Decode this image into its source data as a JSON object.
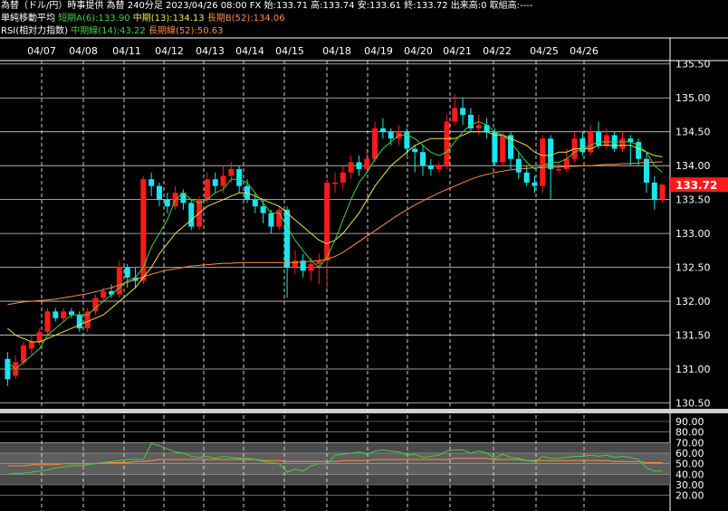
{
  "header": {
    "title_line": "為替（ドル/円）時事提供 為替 240分足 2023/04/26 08:00 FX 始:133.71 高:133.74 安:133.61 終:133.72 出来高:0 取組高:----",
    "ma_label": "単純移動平均",
    "ma_short": "短期A(6):133.90",
    "ma_mid": "中期(13):134.13",
    "ma_long": "長期B(52):134.06",
    "rsi_label": "RSI(相対力指数)",
    "rsi_mid": "中期線(14):43.22",
    "rsi_long": "長期線(52):50.63"
  },
  "colors": {
    "up": "#ff1a1a",
    "down": "#18e6f0",
    "ma_short": "#3fd13f",
    "ma_mid": "#e8e84a",
    "ma_long": "#ff8c42",
    "price_tag": "#ff1a1a"
  },
  "chart_data": [
    {
      "type": "candlestick",
      "title": "為替（ドル/円）240分足",
      "dates": [
        "04/07",
        "04/08",
        "04/11",
        "04/12",
        "04/13",
        "04/14",
        "04/15",
        "04/18",
        "04/19",
        "04/20",
        "04/21",
        "04/22",
        "04/25",
        "04/26"
      ],
      "ylim": [
        130.4,
        135.55
      ],
      "yticks": [
        "135.50",
        "135.00",
        "134.50",
        "134.00",
        "133.50",
        "133.00",
        "132.50",
        "132.00",
        "131.50",
        "131.00",
        "130.50"
      ],
      "last_price": "133.72",
      "candles": [
        [
          131.15,
          130.85,
          131.25,
          130.75
        ],
        [
          130.9,
          131.1,
          131.2,
          130.85
        ],
        [
          131.1,
          131.35,
          131.4,
          131.05
        ],
        [
          131.3,
          131.4,
          131.5,
          131.2
        ],
        [
          131.4,
          131.55,
          131.6,
          131.35
        ],
        [
          131.55,
          131.85,
          131.9,
          131.5
        ],
        [
          131.85,
          131.75,
          131.9,
          131.7
        ],
        [
          131.75,
          131.85,
          131.9,
          131.7
        ],
        [
          131.85,
          131.8,
          131.9,
          131.75
        ],
        [
          131.8,
          131.6,
          131.85,
          131.55
        ],
        [
          131.6,
          131.85,
          131.9,
          131.55
        ],
        [
          131.85,
          132.05,
          132.1,
          131.8
        ],
        [
          132.05,
          132.15,
          132.2,
          132.0
        ],
        [
          132.15,
          132.1,
          132.25,
          132.05
        ],
        [
          132.1,
          132.5,
          132.6,
          132.05
        ],
        [
          132.5,
          132.35,
          132.55,
          132.2
        ],
        [
          132.35,
          132.3,
          132.5,
          132.2
        ],
        [
          132.3,
          133.8,
          133.85,
          132.25
        ],
        [
          133.8,
          133.7,
          133.9,
          133.55
        ],
        [
          133.7,
          133.5,
          133.75,
          133.4
        ],
        [
          133.5,
          133.4,
          133.6,
          133.3
        ],
        [
          133.4,
          133.6,
          133.7,
          133.35
        ],
        [
          133.6,
          133.45,
          133.65,
          133.35
        ],
        [
          133.45,
          133.1,
          133.5,
          133.05
        ],
        [
          133.1,
          133.5,
          133.55,
          133.05
        ],
        [
          133.5,
          133.8,
          133.9,
          133.45
        ],
        [
          133.8,
          133.7,
          133.9,
          133.6
        ],
        [
          133.7,
          133.85,
          134.0,
          133.6
        ],
        [
          133.85,
          133.95,
          134.05,
          133.75
        ],
        [
          133.95,
          133.7,
          134.0,
          133.6
        ],
        [
          133.7,
          133.5,
          133.8,
          133.45
        ],
        [
          133.5,
          133.4,
          133.6,
          133.3
        ],
        [
          133.4,
          133.3,
          133.5,
          133.15
        ],
        [
          133.3,
          133.1,
          133.35,
          133.0
        ],
        [
          133.1,
          133.35,
          133.4,
          133.05
        ],
        [
          133.35,
          132.5,
          133.4,
          132.05
        ],
        [
          132.5,
          132.6,
          132.75,
          132.4
        ],
        [
          132.6,
          132.45,
          132.7,
          132.35
        ],
        [
          132.45,
          132.55,
          132.65,
          132.3
        ],
        [
          132.55,
          132.6,
          132.7,
          132.25
        ],
        [
          132.6,
          133.75,
          133.8,
          132.2
        ],
        [
          133.75,
          133.75,
          133.9,
          133.6
        ],
        [
          133.75,
          133.9,
          134.0,
          133.65
        ],
        [
          133.9,
          134.05,
          134.15,
          133.8
        ],
        [
          134.05,
          133.95,
          134.15,
          133.85
        ],
        [
          133.95,
          134.1,
          134.25,
          133.9
        ],
        [
          134.1,
          134.55,
          134.65,
          134.05
        ],
        [
          134.55,
          134.5,
          134.7,
          134.4
        ],
        [
          134.5,
          134.4,
          134.55,
          134.3
        ],
        [
          134.4,
          134.5,
          134.6,
          134.3
        ],
        [
          134.5,
          134.25,
          134.55,
          134.15
        ],
        [
          134.25,
          134.2,
          134.3,
          133.9
        ],
        [
          134.2,
          134.0,
          134.3,
          133.85
        ],
        [
          134.0,
          133.95,
          134.1,
          133.85
        ],
        [
          133.95,
          134.0,
          134.05,
          133.9
        ],
        [
          134.0,
          134.65,
          134.75,
          133.95
        ],
        [
          134.65,
          134.85,
          135.05,
          134.6
        ],
        [
          134.85,
          134.75,
          135.0,
          134.6
        ],
        [
          134.75,
          134.55,
          134.85,
          134.5
        ],
        [
          134.55,
          134.6,
          134.75,
          134.45
        ],
        [
          134.6,
          134.5,
          134.7,
          134.4
        ],
        [
          134.5,
          134.05,
          134.55,
          134.0
        ],
        [
          134.05,
          134.45,
          134.5,
          134.0
        ],
        [
          134.45,
          134.1,
          134.5,
          133.95
        ],
        [
          134.1,
          133.9,
          134.2,
          133.8
        ],
        [
          133.9,
          133.75,
          134.0,
          133.7
        ],
        [
          133.75,
          133.7,
          133.85,
          133.6
        ],
        [
          133.7,
          134.4,
          134.45,
          133.6
        ],
        [
          134.4,
          133.95,
          134.45,
          133.5
        ],
        [
          133.95,
          133.95,
          134.05,
          133.9
        ],
        [
          133.95,
          134.1,
          134.25,
          133.9
        ],
        [
          134.1,
          134.4,
          134.5,
          134.05
        ],
        [
          134.4,
          134.2,
          134.5,
          134.15
        ],
        [
          134.2,
          134.5,
          134.6,
          134.15
        ],
        [
          134.5,
          134.3,
          134.65,
          134.25
        ],
        [
          134.3,
          134.45,
          134.55,
          134.25
        ],
        [
          134.45,
          134.25,
          134.5,
          134.2
        ],
        [
          134.25,
          134.4,
          134.5,
          134.2
        ],
        [
          134.4,
          134.35,
          134.45,
          134.0
        ],
        [
          134.35,
          134.1,
          134.4,
          134.0
        ],
        [
          134.1,
          133.75,
          134.2,
          133.6
        ],
        [
          133.75,
          133.5,
          133.85,
          133.35
        ],
        [
          133.5,
          133.72,
          133.74,
          133.45
        ]
      ],
      "ma_short_values": [
        131.1,
        131.0,
        131.1,
        131.2,
        131.3,
        131.5,
        131.6,
        131.7,
        131.8,
        131.8,
        131.8,
        131.9,
        132.0,
        132.1,
        132.2,
        132.3,
        132.35,
        132.5,
        132.8,
        133.0,
        133.2,
        133.5,
        133.6,
        133.5,
        133.45,
        133.5,
        133.6,
        133.65,
        133.8,
        133.8,
        133.75,
        133.6,
        133.45,
        133.3,
        133.3,
        133.1,
        132.9,
        132.75,
        132.6,
        132.5,
        132.65,
        132.9,
        133.2,
        133.5,
        133.75,
        133.9,
        134.1,
        134.25,
        134.35,
        134.45,
        134.45,
        134.4,
        134.3,
        134.2,
        134.15,
        134.2,
        134.35,
        134.5,
        134.6,
        134.65,
        134.6,
        134.5,
        134.45,
        134.35,
        134.2,
        134.05,
        133.95,
        134.0,
        134.05,
        134.05,
        134.1,
        134.2,
        134.25,
        134.3,
        134.35,
        134.35,
        134.35,
        134.35,
        134.35,
        134.3,
        134.2,
        134.0,
        133.9
      ],
      "ma_mid_values": [
        131.6,
        131.5,
        131.45,
        131.4,
        131.4,
        131.45,
        131.5,
        131.55,
        131.6,
        131.65,
        131.7,
        131.75,
        131.8,
        131.9,
        132.0,
        132.1,
        132.2,
        132.35,
        132.5,
        132.7,
        132.85,
        133.0,
        133.1,
        133.2,
        133.3,
        133.4,
        133.45,
        133.5,
        133.55,
        133.6,
        133.6,
        133.55,
        133.5,
        133.45,
        133.4,
        133.3,
        133.2,
        133.1,
        133.0,
        132.9,
        132.85,
        132.9,
        133.0,
        133.15,
        133.3,
        133.5,
        133.7,
        133.85,
        134.0,
        134.1,
        134.2,
        134.3,
        134.35,
        134.4,
        134.4,
        134.4,
        134.4,
        134.45,
        134.5,
        134.5,
        134.5,
        134.45,
        134.45,
        134.4,
        134.35,
        134.3,
        134.2,
        134.15,
        134.15,
        134.2,
        134.2,
        134.25,
        134.25,
        134.25,
        134.3,
        134.3,
        134.3,
        134.3,
        134.3,
        134.25,
        134.2,
        134.15,
        134.13
      ],
      "ma_long_values": [
        131.95,
        131.97,
        131.99,
        132.0,
        132.01,
        132.02,
        132.03,
        132.05,
        132.07,
        132.09,
        132.11,
        132.14,
        132.17,
        132.2,
        132.24,
        132.28,
        132.32,
        132.36,
        132.4,
        132.43,
        132.46,
        132.48,
        132.5,
        132.52,
        132.53,
        132.54,
        132.55,
        132.56,
        132.56,
        132.57,
        132.57,
        132.57,
        132.57,
        132.57,
        132.57,
        132.57,
        132.57,
        132.58,
        132.59,
        132.6,
        132.62,
        132.66,
        132.72,
        132.8,
        132.88,
        132.96,
        133.04,
        133.12,
        133.2,
        133.28,
        133.35,
        133.42,
        133.48,
        133.54,
        133.6,
        133.65,
        133.7,
        133.75,
        133.8,
        133.84,
        133.87,
        133.9,
        133.92,
        133.94,
        133.95,
        133.96,
        133.97,
        133.97,
        133.98,
        133.98,
        133.99,
        133.99,
        134.0,
        134.0,
        134.01,
        134.02,
        134.02,
        134.03,
        134.03,
        134.04,
        134.05,
        134.05,
        134.06
      ]
    },
    {
      "type": "line",
      "title": "RSI(相対力指数)",
      "ylim": [
        30,
        90
      ],
      "yticks": [
        "90.00",
        "80.00",
        "70.00",
        "60.00",
        "50.00",
        "40.00",
        "30.00",
        "20.00"
      ],
      "series": [
        {
          "name": "中期線(14)",
          "values": [
            40,
            41,
            41,
            42,
            43,
            44,
            46,
            47,
            48,
            48,
            49,
            50,
            51,
            52,
            53,
            54,
            54,
            54,
            69,
            67,
            64,
            61,
            60,
            57,
            56,
            57,
            55,
            57,
            56,
            55,
            55,
            54,
            52,
            51,
            50,
            42,
            45,
            43,
            48,
            50,
            50,
            58,
            59,
            60,
            61,
            59,
            62,
            63,
            62,
            61,
            58,
            59,
            56,
            57,
            58,
            62,
            63,
            63,
            60,
            62,
            60,
            55,
            59,
            56,
            55,
            53,
            52,
            57,
            55,
            55,
            56,
            57,
            57,
            58,
            57,
            58,
            56,
            57,
            56,
            54,
            46,
            43,
            43
          ]
        },
        {
          "name": "長期線(52)",
          "values": [
            48,
            48,
            48,
            49,
            49,
            49,
            49,
            50,
            50,
            50,
            50,
            50,
            51,
            51,
            51,
            51,
            52,
            52,
            53,
            54,
            54,
            54,
            54,
            54,
            54,
            54,
            54,
            54,
            54,
            54,
            54,
            54,
            53,
            53,
            53,
            52,
            52,
            52,
            52,
            52,
            52,
            52,
            53,
            53,
            53,
            53,
            54,
            54,
            54,
            54,
            54,
            54,
            54,
            54,
            54,
            54,
            55,
            55,
            55,
            55,
            55,
            54,
            54,
            54,
            54,
            53,
            53,
            53,
            53,
            53,
            53,
            53,
            53,
            53,
            53,
            53,
            52,
            52,
            52,
            52,
            51,
            51,
            51
          ]
        }
      ]
    }
  ]
}
